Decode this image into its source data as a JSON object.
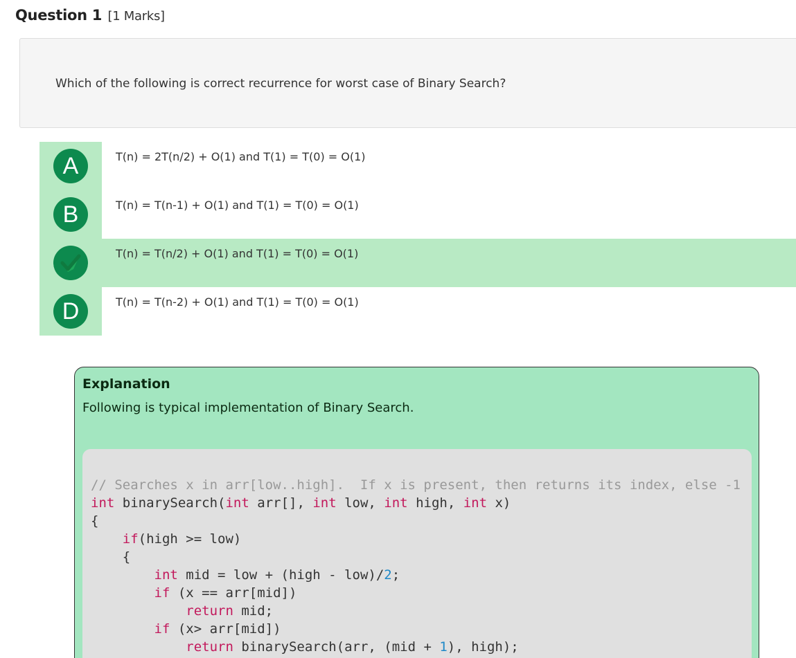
{
  "question": {
    "title": "Question 1",
    "marks": "[1 Marks]",
    "text": "Which of the following is correct recurrence for worst case of Binary Search?"
  },
  "options": [
    {
      "letter": "A",
      "text": "T(n) = 2T(n/2) + O(1) and T(1) = T(0) = O(1)",
      "selected": false
    },
    {
      "letter": "B",
      "text": "T(n) = T(n-1) + O(1) and T(1) = T(0) = O(1)",
      "selected": false
    },
    {
      "letter": "C",
      "text": "T(n) = T(n/2) + O(1) and T(1) = T(0) = O(1)",
      "selected": true
    },
    {
      "letter": "D",
      "text": "T(n) = T(n-2) + O(1) and T(1) = T(0) = O(1)",
      "selected": false
    }
  ],
  "explanation": {
    "title": "Explanation",
    "text": "Following is typical implementation of Binary Search.",
    "code_lines": [
      [
        {
          "t": "// Searches x in arr[low..high].  If x is present, then returns its index, else -1",
          "c": "com"
        }
      ],
      [
        {
          "t": "int",
          "c": "kw"
        },
        {
          "t": " binarySearch(",
          "c": ""
        },
        {
          "t": "int",
          "c": "kw"
        },
        {
          "t": " arr[], ",
          "c": ""
        },
        {
          "t": "int",
          "c": "kw"
        },
        {
          "t": " low, ",
          "c": ""
        },
        {
          "t": "int",
          "c": "kw"
        },
        {
          "t": " high, ",
          "c": ""
        },
        {
          "t": "int",
          "c": "kw"
        },
        {
          "t": " x)",
          "c": ""
        }
      ],
      [
        {
          "t": "{",
          "c": ""
        }
      ],
      [
        {
          "t": "    ",
          "c": ""
        },
        {
          "t": "if",
          "c": "kw"
        },
        {
          "t": "(high >= low)",
          "c": ""
        }
      ],
      [
        {
          "t": "    {",
          "c": ""
        }
      ],
      [
        {
          "t": "        ",
          "c": ""
        },
        {
          "t": "int",
          "c": "kw"
        },
        {
          "t": " mid = low + (high - low)/",
          "c": ""
        },
        {
          "t": "2",
          "c": "num"
        },
        {
          "t": ";",
          "c": ""
        }
      ],
      [
        {
          "t": "        ",
          "c": ""
        },
        {
          "t": "if",
          "c": "kw"
        },
        {
          "t": " (x == arr[mid])",
          "c": ""
        }
      ],
      [
        {
          "t": "            ",
          "c": ""
        },
        {
          "t": "return",
          "c": "kw"
        },
        {
          "t": " mid;",
          "c": ""
        }
      ],
      [
        {
          "t": "        ",
          "c": ""
        },
        {
          "t": "if",
          "c": "kw"
        },
        {
          "t": " (x> arr[mid])",
          "c": ""
        }
      ],
      [
        {
          "t": "            ",
          "c": ""
        },
        {
          "t": "return",
          "c": "kw"
        },
        {
          "t": " binarySearch(arr, (mid + ",
          "c": ""
        },
        {
          "t": "1",
          "c": "num"
        },
        {
          "t": "), high);",
          "c": ""
        }
      ]
    ]
  },
  "colors": {
    "option_highlight": "#b8eac4",
    "badge": "#0d8a4e",
    "explanation_bg": "#a3e6c0",
    "code_bg": "#e0e0e0",
    "keyword": "#c2185b",
    "comment": "#999999",
    "number": "#1e88c7"
  },
  "icons": {
    "selected_option": "checkmark-icon"
  }
}
